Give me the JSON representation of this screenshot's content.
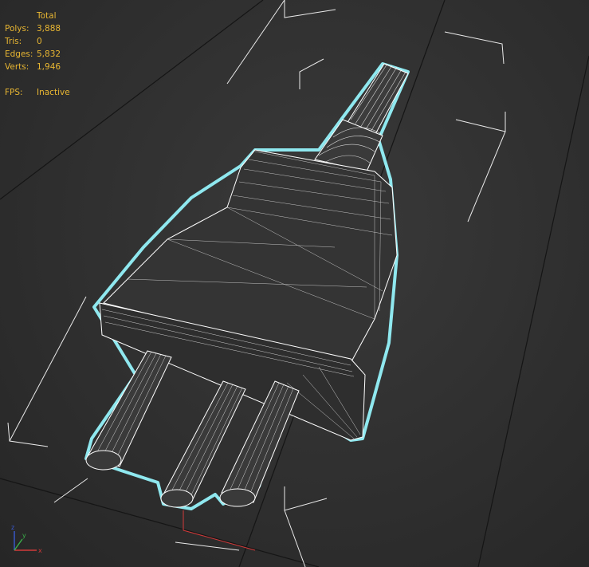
{
  "stats": {
    "header": "Total",
    "rows": [
      {
        "label": "Polys:",
        "value": "3,888"
      },
      {
        "label": "Tris:",
        "value": "0"
      },
      {
        "label": "Edges:",
        "value": "5,832"
      },
      {
        "label": "Verts:",
        "value": "1,946"
      }
    ],
    "fps": {
      "label": "FPS:",
      "value": "Inactive"
    }
  },
  "colors": {
    "stats_text": "#e8b632",
    "selection_outline": "#8fe8ef",
    "wireframe": "#ffffff",
    "grid": "#151515",
    "bounding_box": "#ffffff",
    "axis_x": "#d23a3a",
    "axis_y": "#3ab04a",
    "axis_z": "#3a5ad2"
  },
  "gizmo": {
    "icon": "axis-tripod-icon"
  }
}
